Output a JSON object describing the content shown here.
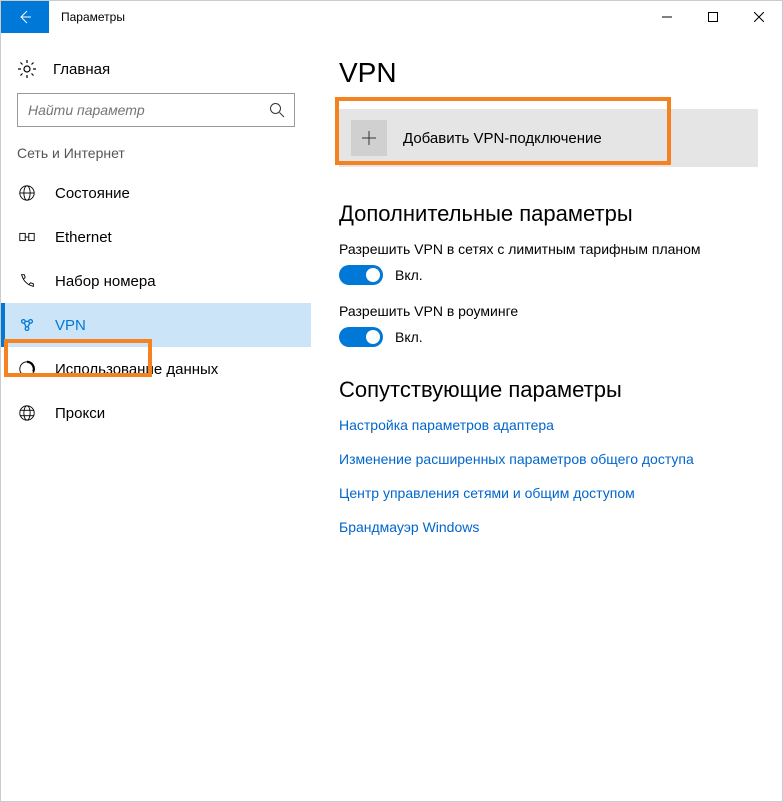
{
  "window": {
    "title": "Параметры"
  },
  "sidebar": {
    "home_label": "Главная",
    "search_placeholder": "Найти параметр",
    "category": "Сеть и Интернет",
    "items": [
      {
        "label": "Состояние"
      },
      {
        "label": "Ethernet"
      },
      {
        "label": "Набор номера"
      },
      {
        "label": "VPN"
      },
      {
        "label": "Использование данных"
      },
      {
        "label": "Прокси"
      }
    ]
  },
  "main": {
    "title": "VPN",
    "add_vpn_label": "Добавить VPN-подключение",
    "advanced_heading": "Дополнительные параметры",
    "settings": [
      {
        "label": "Разрешить VPN в сетях с лимитным тарифным планом",
        "state": "Вкл."
      },
      {
        "label": "Разрешить VPN в роуминге",
        "state": "Вкл."
      }
    ],
    "related_heading": "Сопутствующие параметры",
    "links": [
      "Настройка параметров адаптера",
      "Изменение расширенных параметров общего доступа",
      "Центр управления сетями и общим доступом",
      "Брандмауэр Windows"
    ]
  }
}
